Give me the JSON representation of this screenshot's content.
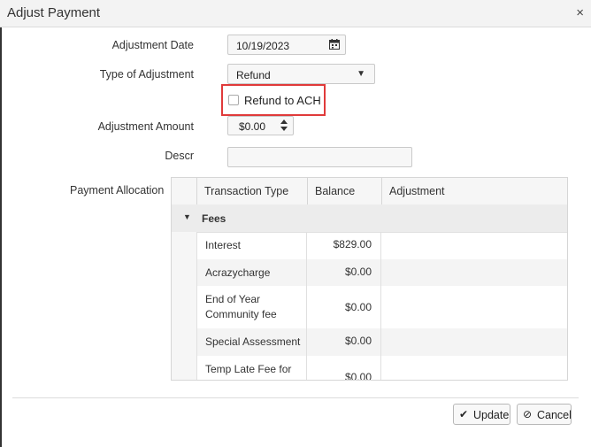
{
  "dialog": {
    "title": "Adjust Payment",
    "close_glyph": "×"
  },
  "form": {
    "adjustment_date": {
      "label": "Adjustment Date",
      "value": "10/19/2023"
    },
    "type_of_adjustment": {
      "label": "Type of Adjustment",
      "value": "Refund"
    },
    "refund_to_ach": {
      "label": "Refund to ACH",
      "checked": false
    },
    "adjustment_amount": {
      "label": "Adjustment Amount",
      "value": "$0.00"
    },
    "descr": {
      "label": "Descr",
      "value": ""
    },
    "payment_allocation_label": "Payment Allocation"
  },
  "grid": {
    "columns": [
      "Transaction Type",
      "Balance",
      "Adjustment"
    ],
    "group": "Fees",
    "rows": [
      {
        "type": "Interest",
        "balance": "$829.00",
        "adjustment": ""
      },
      {
        "type": "Acrazycharge",
        "balance": "$0.00",
        "adjustment": ""
      },
      {
        "type": "End of Year Community fee",
        "balance": "$0.00",
        "adjustment": ""
      },
      {
        "type": "Special Assessment",
        "balance": "$0.00",
        "adjustment": ""
      },
      {
        "type": "Temp Late Fee for",
        "balance": "$0.00",
        "adjustment": ""
      }
    ]
  },
  "footer": {
    "update_label": "Update",
    "cancel_label": "Cancel"
  },
  "colors": {
    "highlight": "#e03a3a"
  }
}
